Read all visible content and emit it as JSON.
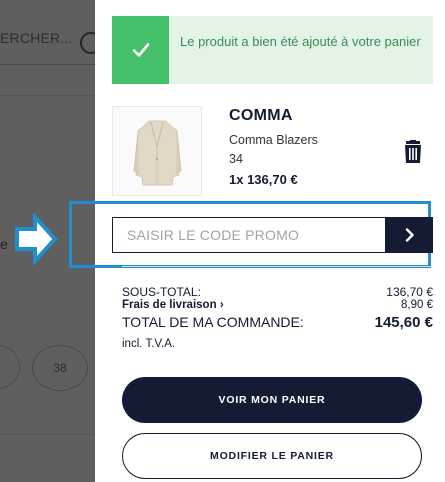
{
  "background": {
    "search_text": "ERCHER...",
    "text_fragment": "e",
    "size_option": "38"
  },
  "notice": {
    "icon": "checkmark-icon",
    "message": "Le produit a bien été ajouté à votre panier",
    "bg_color": "#e3f4e6",
    "accent_color": "#44c06a"
  },
  "product": {
    "brand": "COMMA",
    "name": "Comma Blazers",
    "size": "34",
    "quantity_price": "1x 136,70 €",
    "image_icon": "blazer-image",
    "delete_icon": "trash-icon"
  },
  "promo": {
    "placeholder": "SAISIR LE CODE PROMO",
    "submit_icon": "chevron-right-icon"
  },
  "summary": {
    "subtotal_label": "SOUS-TOTAL:",
    "subtotal_value": "136,70 €",
    "shipping_label": "Frais de livraison",
    "shipping_value": "8,90 €",
    "total_label": "TOTAL DE MA COMMANDE:",
    "total_value": "145,60 €",
    "vat_note": "incl. T.V.A."
  },
  "actions": {
    "view_cart": "VOIR MON PANIER",
    "edit_cart": "MODIFIER LE PANIER"
  },
  "colors": {
    "navy": "#141c33",
    "highlight_blue": "#1f8fd0"
  }
}
